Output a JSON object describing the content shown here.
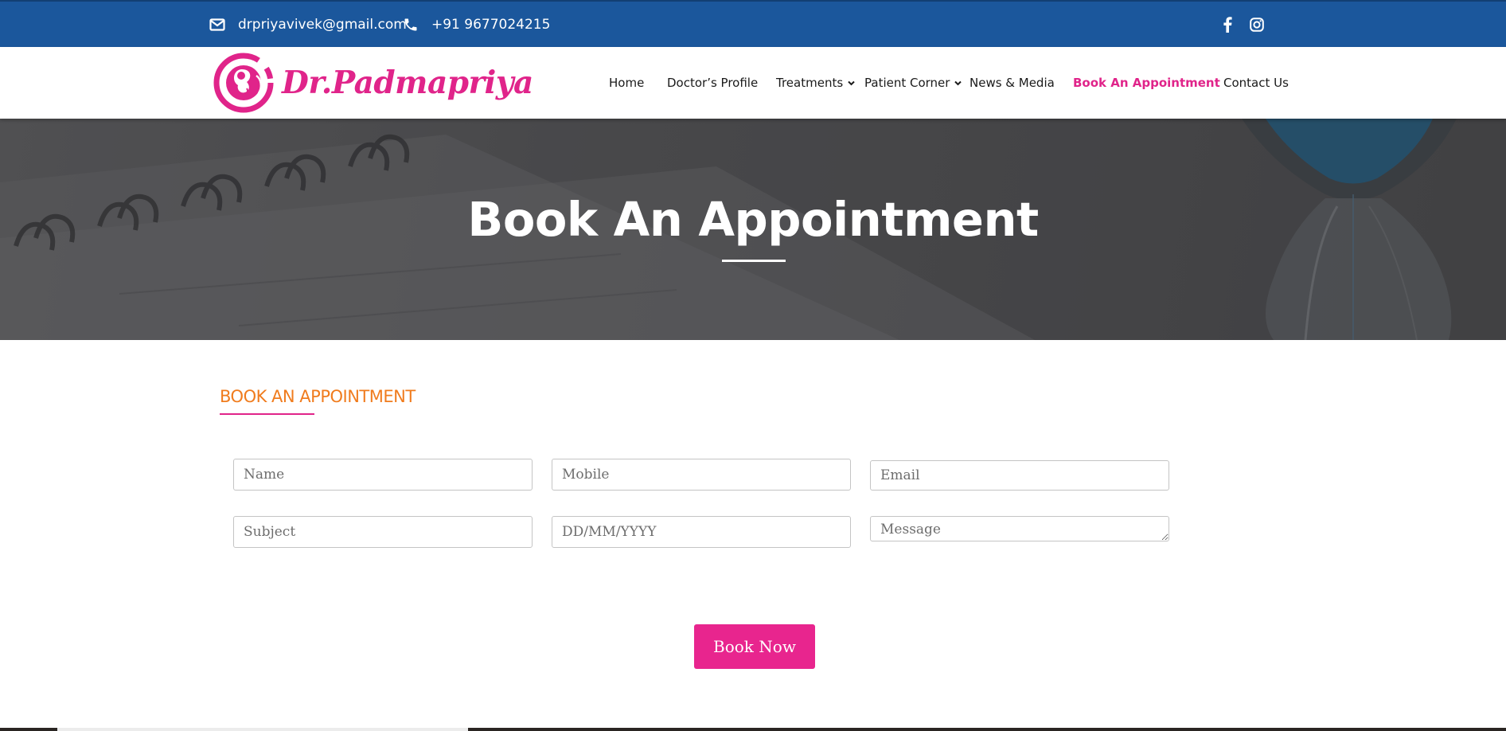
{
  "topbar": {
    "email": "drpriyavivek@gmail.com",
    "phone": "+91 9677024215",
    "icons": {
      "email": "envelope-icon",
      "phone": "phone-icon",
      "facebook": "facebook-icon",
      "instagram": "instagram-icon"
    }
  },
  "brand": {
    "logo_text": "Dr.Padmapriya",
    "color": "#e0248a"
  },
  "nav": {
    "items": [
      {
        "label": "Home"
      },
      {
        "label": "Doctor’s Profile"
      },
      {
        "label": "Treatments"
      },
      {
        "label": "Patient Corner"
      },
      {
        "label": "News & Media"
      },
      {
        "label": "Book An Appointment",
        "active": true
      },
      {
        "label": "Contact Us"
      }
    ]
  },
  "hero": {
    "title": "Book An Appointment"
  },
  "form": {
    "section_title": "BOOK AN APPOINTMENT",
    "fields": {
      "name": {
        "placeholder": "Name"
      },
      "mobile": {
        "placeholder": "Mobile"
      },
      "email": {
        "placeholder": "Email"
      },
      "subject": {
        "placeholder": "Subject"
      },
      "date": {
        "placeholder": "DD/MM/YYYY"
      },
      "message": {
        "placeholder": "Message"
      }
    },
    "submit_label": "Book Now"
  },
  "colors": {
    "topbar": "#1b579c",
    "accent_pink": "#e8258e",
    "section_title": "#f07c1e"
  }
}
